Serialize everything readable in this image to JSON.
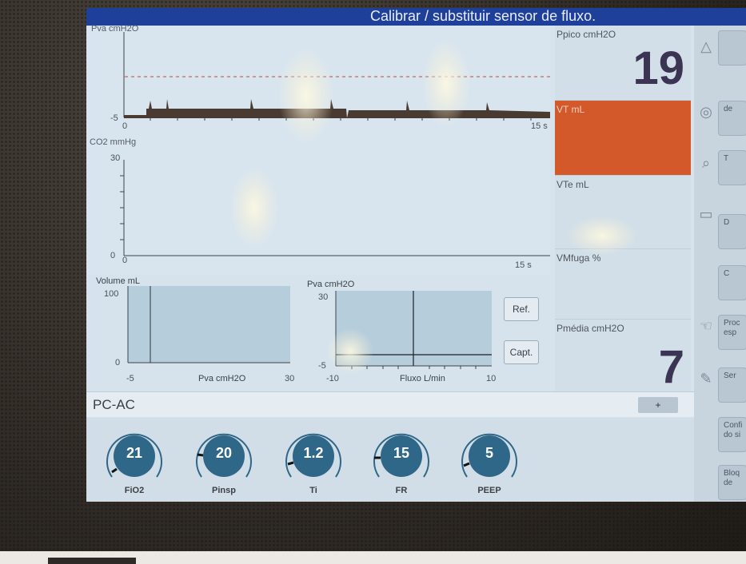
{
  "alarm_banner": "Calibrar / substituir sensor de fluxo.",
  "waveforms": {
    "pressure": {
      "label": "Pva cmH2O",
      "y_top": "",
      "y_bottom": "-5",
      "x_start": "0",
      "x_end": "15 s"
    },
    "co2": {
      "label": "CO2 mmHg",
      "y_top": "30",
      "y_bottom": "0",
      "x_start": "0",
      "x_end": "15 s"
    }
  },
  "loops": {
    "volume_pressure": {
      "y_label": "Volume mL",
      "y_top": "100",
      "y_bottom": "0",
      "x_label": "Pva cmH2O",
      "x_min": "-5",
      "x_max": "30"
    },
    "pressure_flow": {
      "y_label": "Pva cmH2O",
      "y_top": "30",
      "y_bottom": "-5",
      "x_label": "Fluxo L/min",
      "x_min": "-10",
      "x_max": "10"
    }
  },
  "loop_buttons": {
    "ref": "Ref.",
    "capt": "Capt."
  },
  "monitoring": {
    "ppico": {
      "label": "Ppico cmH2O",
      "value": "19"
    },
    "vt": {
      "label": "VT mL",
      "value": "",
      "color": "#d3592b"
    },
    "vte": {
      "label": "VTe mL",
      "value": ""
    },
    "vmfuga": {
      "label": "VMfuga %",
      "value": ""
    },
    "pmedia": {
      "label": "Pmédia cmH2O",
      "value": "7"
    }
  },
  "side_buttons": [
    {
      "label": "",
      "icon": "alarm-triangle-icon"
    },
    {
      "label": "de",
      "icon": "sensor-loop-icon"
    },
    {
      "label": "T",
      "icon": "zoom-icon"
    },
    {
      "label": "D",
      "icon": "window-icon"
    },
    {
      "label": "C",
      "icon": ""
    },
    {
      "label": "Proc esp",
      "icon": "hand-icon"
    },
    {
      "label": "Ser",
      "icon": "tools-icon"
    },
    {
      "label": "Confi do si",
      "icon": ""
    },
    {
      "label": "Bloq de",
      "icon": ""
    }
  ],
  "mode": {
    "name": "PC-AC",
    "plus": "+"
  },
  "knobs": [
    {
      "value": "21",
      "label": "FiO2"
    },
    {
      "value": "20",
      "label": "Pinsp"
    },
    {
      "value": "1.2",
      "label": "Ti"
    },
    {
      "value": "15",
      "label": "FR"
    },
    {
      "value": "5",
      "label": "PEEP"
    }
  ],
  "colors": {
    "topbar": "#1e3f9a",
    "knob_fill": "#2f6788",
    "vt_alarm": "#d3592b",
    "big_numbers": "#3b3452"
  }
}
